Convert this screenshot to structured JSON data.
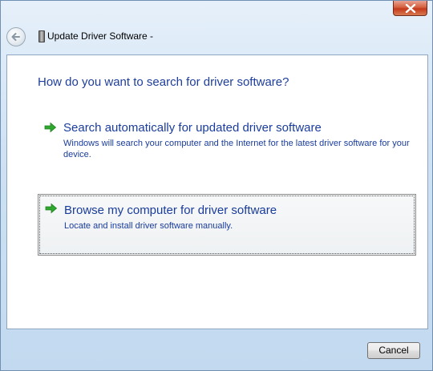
{
  "window": {
    "title": "Update Driver Software -",
    "close_icon": "close-icon",
    "back_icon": "back-arrow-icon"
  },
  "main": {
    "question": "How do you want to search for driver software?",
    "options": [
      {
        "title": "Search automatically for updated driver software",
        "description": "Windows will search your computer and the Internet for the latest driver software for your device.",
        "icon": "green-arrow-icon"
      },
      {
        "title": "Browse my computer for driver software",
        "description": "Locate and install driver software manually.",
        "icon": "green-arrow-icon"
      }
    ]
  },
  "footer": {
    "cancel_label": "Cancel"
  },
  "colors": {
    "link_blue": "#1a3c9c",
    "arrow_green": "#2ea82e",
    "close_red": "#c4391c"
  }
}
